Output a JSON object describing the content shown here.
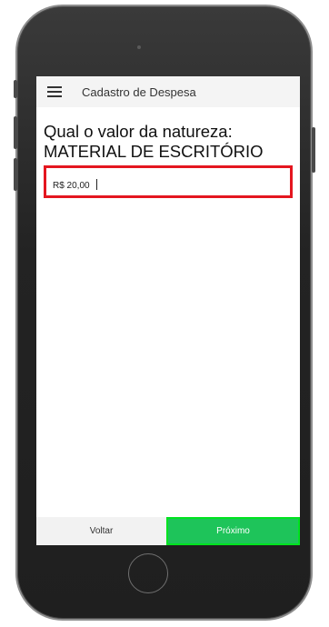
{
  "header": {
    "menu_icon": "hamburger-menu-icon",
    "title": "Cadastro de Despesa"
  },
  "main": {
    "question_line1": "Qual o valor da natureza:",
    "question_line2": "MATERIAL DE ESCRITÓRIO",
    "value_input": {
      "value": "R$ 20,00"
    },
    "highlight_color": "#e4161f"
  },
  "footer": {
    "back_label": "Voltar",
    "next_label": "Próximo",
    "next_color": "#1ec45a",
    "next_highlight_color": "#00e31f"
  }
}
